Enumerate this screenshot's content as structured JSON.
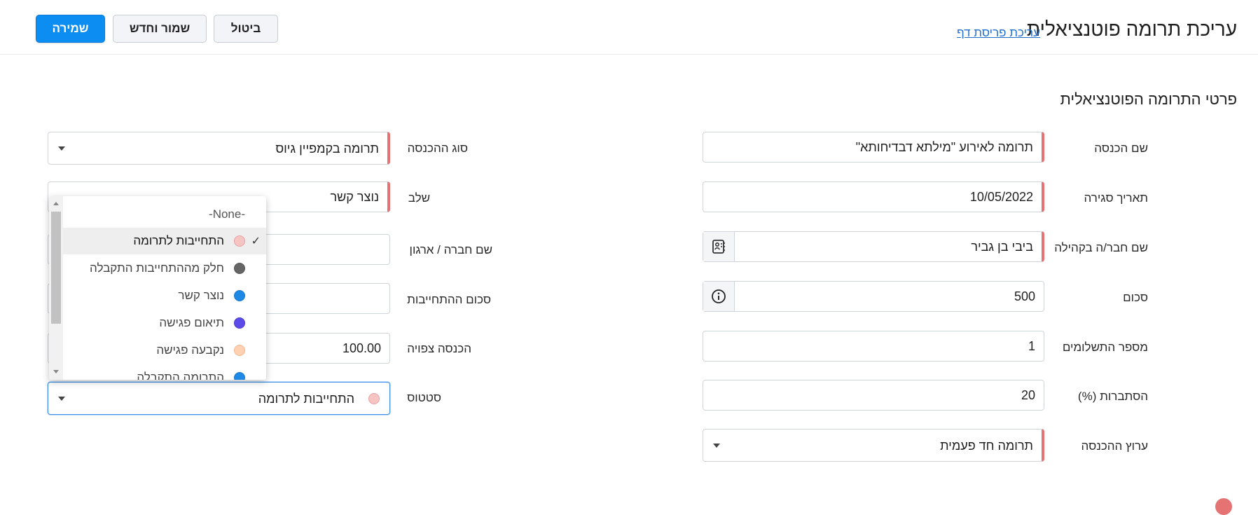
{
  "header": {
    "title": "עריכת תרומה פוטנציאלית",
    "layout_link": "עריכת פריסת דף",
    "save_label": "שמירה",
    "save_new_label": "שמור וחדש",
    "cancel_label": "ביטול"
  },
  "section": {
    "title": "פרטי התרומה הפוטנציאלית"
  },
  "right_fields": {
    "income_name": {
      "label": "שם הכנסה",
      "value": "תרומה לאירוע \"מילתא דבדיחותא\""
    },
    "close_date": {
      "label": "תאריך סגירה",
      "value": "10/05/2022"
    },
    "member_name": {
      "label": "שם חבר/ה בקהילה",
      "value": "ביבי בן גביר",
      "icon": "contact-card-icon"
    },
    "amount": {
      "label": "סכום",
      "value": "500",
      "icon": "info-icon"
    },
    "payments_count": {
      "label": "מספר התשלומים",
      "value": "1"
    },
    "probability": {
      "label": "הסתברות (%)",
      "value": "20"
    },
    "income_channel": {
      "label": "ערוץ ההכנסה",
      "value": "תרומה חד פעמית"
    }
  },
  "left_fields": {
    "income_type": {
      "label": "סוג ההכנסה",
      "value": "תרומה בקמפיין גיוס"
    },
    "stage": {
      "label": "שלב",
      "value": "נוצר קשר"
    },
    "company_name": {
      "label": "שם חברה / ארגון",
      "value": ""
    },
    "commitment_amount": {
      "label": "סכום ההתחייבות",
      "value": ""
    },
    "expected_income": {
      "label": "הכנסה צפויה",
      "value": "100.00"
    },
    "status": {
      "label": "סטטוס",
      "value": "התחייבות לתרומה",
      "dot_color": "#f7c4c4",
      "dot_border": "#e8a0a0"
    }
  },
  "status_dropdown": {
    "none_option": "-None-",
    "options": [
      {
        "label": "התחייבות לתרומה",
        "color": "#f7c4c4",
        "border": "#e8a0a0",
        "selected": true
      },
      {
        "label": "חלק מההתחייבות התקבלה",
        "color": "#666666",
        "border": "#555555",
        "selected": false
      },
      {
        "label": "נוצר קשר",
        "color": "#1e88e5",
        "border": "#1a78cc",
        "selected": false
      },
      {
        "label": "תיאום פגישה",
        "color": "#5c4be8",
        "border": "#4b3bd0",
        "selected": false
      },
      {
        "label": "נקבעה פגישה",
        "color": "#ffd1b3",
        "border": "#f0b890",
        "selected": false
      },
      {
        "label": "התרומה התקבלה",
        "color": "#1e88e5",
        "border": "#1a78cc",
        "selected": false
      }
    ]
  },
  "colors": {
    "accent": "#0b8df2",
    "required": "#e57373",
    "link": "#1f6fd1"
  }
}
